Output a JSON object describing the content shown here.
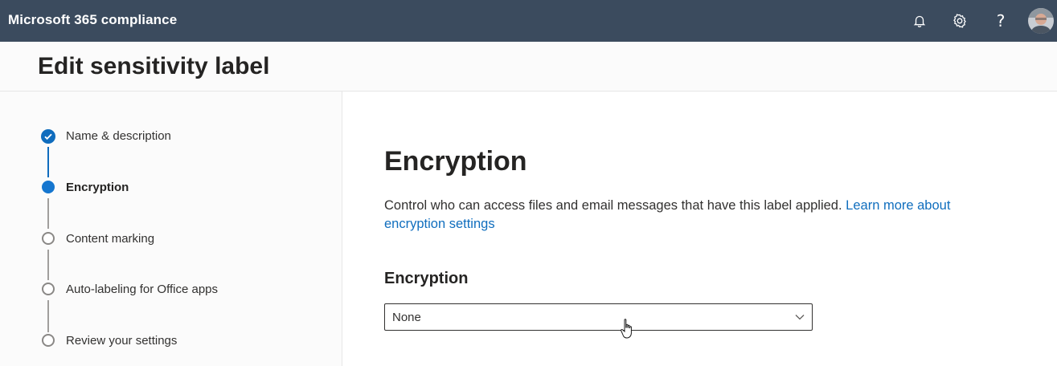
{
  "topbar": {
    "app_title": "Microsoft 365 compliance",
    "icons": [
      "bell-icon",
      "gear-icon",
      "help-icon",
      "avatar"
    ],
    "help_glyph": "?"
  },
  "header": {
    "title": "Edit sensitivity label"
  },
  "steps": [
    {
      "label": "Name & description",
      "state": "complete"
    },
    {
      "label": "Encryption",
      "state": "current"
    },
    {
      "label": "Content marking",
      "state": "todo"
    },
    {
      "label": "Auto-labeling for Office apps",
      "state": "todo"
    },
    {
      "label": "Review your settings",
      "state": "todo"
    }
  ],
  "main": {
    "section_title": "Encryption",
    "description": "Control who can access files and email messages that have this label applied.",
    "learn_more_link": "Learn more about encryption settings",
    "field_label": "Encryption",
    "dropdown_value": "None"
  },
  "colors": {
    "topbar_bg": "#3b4b5e",
    "accent": "#0f6cbd",
    "link": "#106ebe"
  }
}
